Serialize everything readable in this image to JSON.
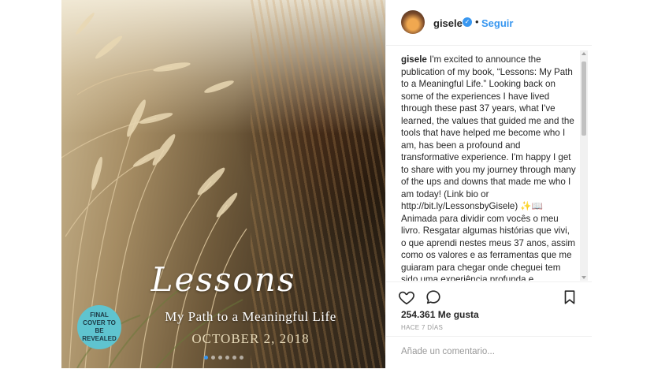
{
  "post": {
    "image": {
      "cover_title": "Lessons",
      "cover_subtitle": "My Path to a Meaningful Life",
      "cover_date": "OCTOBER 2, 2018",
      "badge_text": "FINAL COVER TO BE REVEALED",
      "carousel": {
        "total": 6,
        "active_index": 0
      }
    },
    "header": {
      "username": "gisele",
      "separator": "•",
      "follow_label": "Seguir"
    },
    "caption": {
      "username": "gisele",
      "text": "I'm excited to announce the publication of my book, “Lessons: My Path to a Meaningful Life.” Looking back on some of the experiences I have lived through these past 37 years, what I've learned, the values that guided me and the tools that have helped me become who I am, has been a profound and transformative experience. I'm happy I get to share with you my journey through many of the ups and downs that made me who I am today! (Link bio or http://bit.ly/LessonsbyGisele) ✨📖 Animada para dividir com vocês o meu livro. Resgatar algumas histórias que vivi, o que aprendi nestes meus 37 anos, assim como os valores e as ferramentas que me guiaram para chegar onde cheguei tem sido uma experiência profunda e transformadora. Fico feliz em poder compartilhar um pouco desta jornada de"
    },
    "actions": {
      "likes": "254.361 Me gusta",
      "time_ago": "HACE 7 DÍAS"
    },
    "comment": {
      "placeholder": "Añade un comentario..."
    },
    "icons": [
      "heart-icon",
      "comment-icon",
      "bookmark-icon",
      "verified-icon"
    ],
    "colors": {
      "accent": "#3897f0",
      "badge": "#5fc4cf",
      "text": "#262626",
      "muted": "#999999"
    }
  }
}
